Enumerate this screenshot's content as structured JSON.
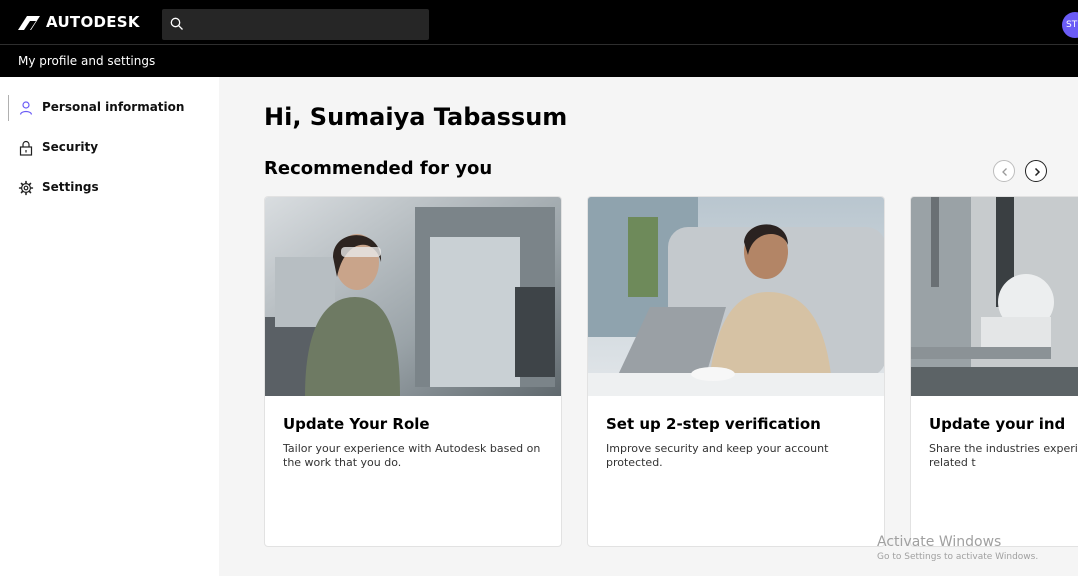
{
  "app": {
    "brand": "AUTODESK",
    "avatar_initials": "ST",
    "page_header": "My profile and settings"
  },
  "search": {
    "value": "",
    "placeholder": ""
  },
  "sidebar": {
    "items": [
      {
        "label": "Personal information",
        "icon": "person-icon",
        "active": true
      },
      {
        "label": "Security",
        "icon": "lock-icon",
        "active": false
      },
      {
        "label": "Settings",
        "icon": "gear-icon",
        "active": false
      }
    ]
  },
  "main": {
    "greeting": "Hi, Sumaiya Tabassum",
    "section_title": "Recommended for you",
    "cards": [
      {
        "title": "Update Your Role",
        "description": "Tailor your experience with Autodesk based on the work that you do."
      },
      {
        "title": "Set up 2-step verification",
        "description": "Improve security and keep your account protected."
      },
      {
        "title": "Update your ind",
        "description": "Share the industries experiences related t"
      }
    ]
  },
  "watermark": {
    "title": "Activate Windows",
    "subtitle": "Go to Settings to activate Windows."
  },
  "colors": {
    "topbar": "#000000",
    "avatar": "#6b5cf6",
    "main_background": "#f5f5f5"
  }
}
